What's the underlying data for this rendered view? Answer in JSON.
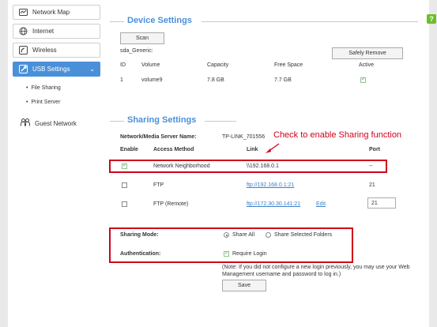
{
  "sidebar": {
    "items": [
      {
        "label": "Network Map",
        "icon": "network-map-icon"
      },
      {
        "label": "Internet",
        "icon": "globe-icon"
      },
      {
        "label": "Wireless",
        "icon": "wireless-icon"
      },
      {
        "label": "USB Settings",
        "icon": "usb-icon"
      }
    ],
    "sub_items": [
      "File Sharing",
      "Print Server"
    ],
    "guest_network": "Guest Network"
  },
  "help": {
    "label": "?",
    "color": "#6cbf2a"
  },
  "device_settings": {
    "title": "Device Settings",
    "scan_label": "Scan",
    "device_name": "sda_Generic:",
    "safely_remove_label": "Safely Remove",
    "columns": [
      "ID",
      "Volume",
      "Capacity",
      "Free Space",
      "Active"
    ],
    "rows": [
      {
        "id": "1",
        "volume": "volume9",
        "capacity": "7.8 GB",
        "free": "7.7 GB",
        "active": true
      }
    ]
  },
  "sharing_settings": {
    "title": "Sharing Settings",
    "server_name_label": "Network/Media Server Name:",
    "server_name_value": "TP-LINK_701556",
    "annotation": "Check to enable Sharing function",
    "columns": [
      "Enable",
      "Access Method",
      "Link",
      "Port"
    ],
    "rows": [
      {
        "enabled": true,
        "method": "Network Neighborhood",
        "link": "\\\\192.168.0.1",
        "port": "--"
      },
      {
        "enabled": false,
        "method": "FTP",
        "link": "ftp://192.168.0.1:21",
        "port": "21"
      },
      {
        "enabled": false,
        "method": "FTP (Remote)",
        "link": "ftp://172.30.30.141:21",
        "edit": "Edit",
        "port": "21"
      }
    ],
    "sharing_mode_label": "Sharing Mode:",
    "share_all_label": "Share All",
    "share_selected_label": "Share Selected Folders",
    "authentication_label": "Authentication:",
    "require_login_label": "Require Login",
    "note": "(Note: If you did not configure a new login previously, you may use your Web Management username and password to log in.)",
    "save_label": "Save"
  },
  "colors": {
    "accent": "#4a90d9",
    "highlight": "#d0021b"
  }
}
